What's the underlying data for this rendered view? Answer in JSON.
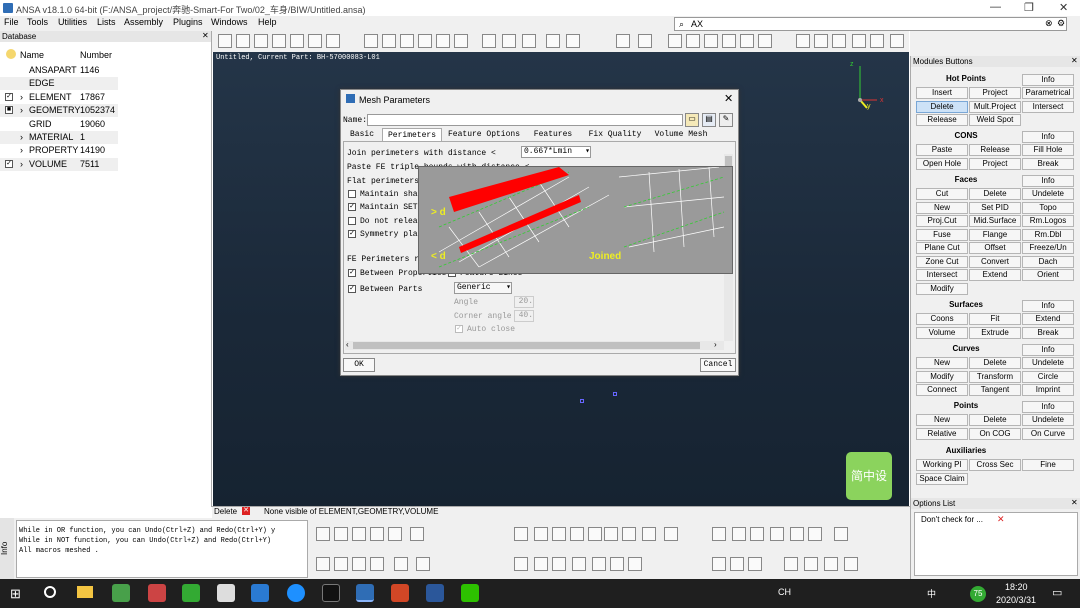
{
  "window": {
    "title": "ANSA v18.1.0 64-bit (F:/ANSA_project/奔驰-Smart-For Two/02_车身/BIW/Untitled.ansa)",
    "search": "AX"
  },
  "menus": [
    "File",
    "Tools",
    "Utilities",
    "Lists",
    "Assembly",
    "Plugins",
    "Windows",
    "Help"
  ],
  "database": {
    "title": "Database",
    "col_name": "Name",
    "col_number": "Number",
    "rows": [
      {
        "name": "ANSAPART",
        "number": "1146"
      },
      {
        "name": "EDGE",
        "number": ""
      },
      {
        "name": "ELEMENT",
        "number": "17867"
      },
      {
        "name": "GEOMETRY",
        "number": "1052374"
      },
      {
        "name": "GRID",
        "number": "19060"
      },
      {
        "name": "MATERIAL",
        "number": "1"
      },
      {
        "name": "PROPERTY",
        "number": "14190"
      },
      {
        "name": "VOLUME",
        "number": "7511"
      }
    ]
  },
  "viewport": {
    "status": "Untitled,  Current Part: BH-57000083-L01",
    "axes": {
      "x": "x",
      "y": "y",
      "z": "z"
    }
  },
  "dialog": {
    "title": "Mesh Parameters",
    "name_label": "Name:",
    "tabs": [
      "Basic",
      "Perimeters",
      "Feature Options",
      "Features",
      "Fix Quality",
      "Volume Mesh"
    ],
    "join_label": "Join perimeters with distance <",
    "join_value": "0.667*Lmin",
    "paste_label": "Paste FE triple bounds with distance <",
    "flat_label": "Flat perimeters",
    "cb1": "Maintain sha",
    "cb2": "Maintain SET",
    "cb3": "Do not relea",
    "cb4": "Symmetry pla",
    "fe_label": "FE Perimeters r",
    "between_props": "Between Properties",
    "feature_lines": "Feature Lines",
    "between_parts": "Between Parts",
    "generic": "Generic",
    "angle_label": "Angle",
    "angle_value": "20.",
    "corner_label": "Corner angle",
    "corner_value": "40.",
    "auto_close": "Auto close",
    "illus_gt": "> d",
    "illus_lt": "< d",
    "illus_joined": "Joined",
    "ok": "OK",
    "cancel": "Cancel"
  },
  "modules": {
    "title": "Modules Buttons",
    "hot_points": "Hot Points",
    "cons": "CONS",
    "faces": "Faces",
    "surfaces": "Surfaces",
    "curves": "Curves",
    "points": "Points",
    "auxiliaries": "Auxiliaries",
    "info": "Info",
    "hp": [
      "Insert",
      "Project",
      "Parametrical",
      "Delete",
      "Mult.Project",
      "Intersect",
      "Release",
      "Weld Spot"
    ],
    "cn": [
      "Paste",
      "Release",
      "Fill Hole",
      "Open Hole",
      "Project",
      "Break"
    ],
    "fc": [
      "Cut",
      "Delete",
      "Undelete",
      "New",
      "Set PID",
      "Topo",
      "Proj.Cut",
      "Mid.Surface",
      "Rm.Logos",
      "Fuse",
      "Flange",
      "Rm.Dbl",
      "Plane Cut",
      "Offset",
      "Freeze/Un",
      "Zone Cut",
      "Convert",
      "Dach",
      "Intersect",
      "Extend",
      "Orient",
      "Modify"
    ],
    "sf": [
      "Coons",
      "Fit",
      "Extend",
      "Volume",
      "Extrude",
      "Break"
    ],
    "cv": [
      "New",
      "Delete",
      "Undelete",
      "Modify",
      "Transform",
      "Circle",
      "Connect",
      "Tangent",
      "Imprint"
    ],
    "pt": [
      "New",
      "Delete",
      "Undelete",
      "Relative",
      "On COG",
      "On Curve"
    ],
    "ax": [
      "Working Pl",
      "Cross Sec",
      "Fine",
      "Space Claim"
    ]
  },
  "statusbar": {
    "delete": "Delete",
    "message": "None visible of ELEMENT,GEOMETRY,VOLUME"
  },
  "console": [
    "While in OR function, you can Undo(Ctrl+Z) and Redo(Ctrl+Y) y",
    "While in NOT function, you can Undo(Ctrl+Z) and Redo(Ctrl+Y)",
    " All macros meshed ."
  ],
  "info_tab": "Info",
  "options_list": {
    "title": "Options List",
    "item": "Don't check for ..."
  },
  "watermark": "简中设",
  "taskbar": {
    "lang": "CH",
    "ime": "中",
    "time": "18:20",
    "date": "2020/3/31",
    "badge": "75"
  }
}
